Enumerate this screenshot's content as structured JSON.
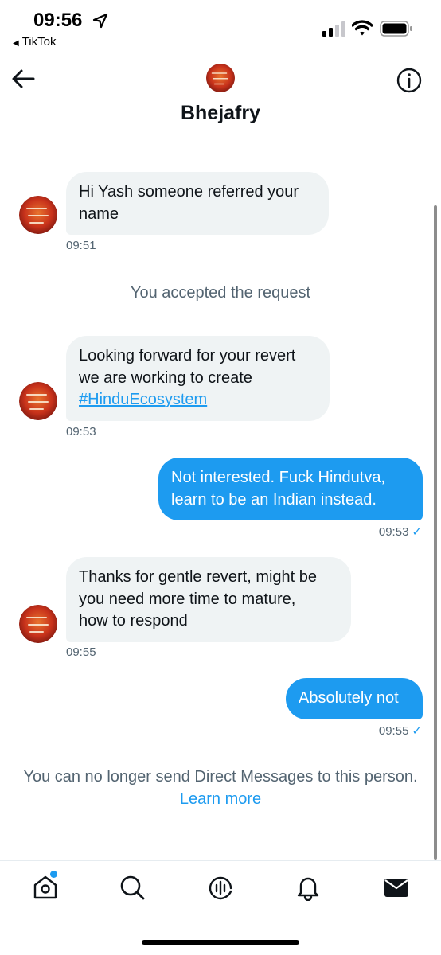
{
  "status_bar": {
    "time": "09:56",
    "back_app_label": "TikTok"
  },
  "header": {
    "name": "Bhejafry",
    "avatar_icon": "profile-avatar-icon",
    "back_icon": "back-arrow-icon",
    "info_icon": "info-icon"
  },
  "messages": [
    {
      "direction": "in",
      "lines": [
        "Hi Yash someone referred your",
        "name"
      ],
      "time": "09:51"
    },
    {
      "direction": "in",
      "lines": [
        "Looking forward for your revert",
        "we are working to create"
      ],
      "hashtag": "#HinduEcosystem",
      "time": "09:53"
    },
    {
      "direction": "out",
      "lines": [
        "Not interested. Fuck Hindutva,",
        "learn to be an Indian instead."
      ],
      "time": "09:53"
    },
    {
      "direction": "in",
      "lines": [
        "Thanks for gentle revert, might be",
        "you need more time to mature,",
        "how to respond"
      ],
      "time": "09:55"
    },
    {
      "direction": "out",
      "lines": [
        "Absolutely not"
      ],
      "time": "09:55"
    }
  ],
  "system": {
    "accepted_request": "You accepted the request",
    "blocked_notice": "You can no longer send Direct Messages to this person.",
    "learn_more": "Learn more"
  },
  "read_check": "✓",
  "colors": {
    "accent": "#1d9bf0",
    "incoming_bubble": "#eff3f4",
    "secondary_text": "#536471"
  },
  "bottom_nav": {
    "items": [
      "home-icon",
      "search-icon",
      "spaces-icon",
      "notifications-icon",
      "messages-icon"
    ]
  }
}
